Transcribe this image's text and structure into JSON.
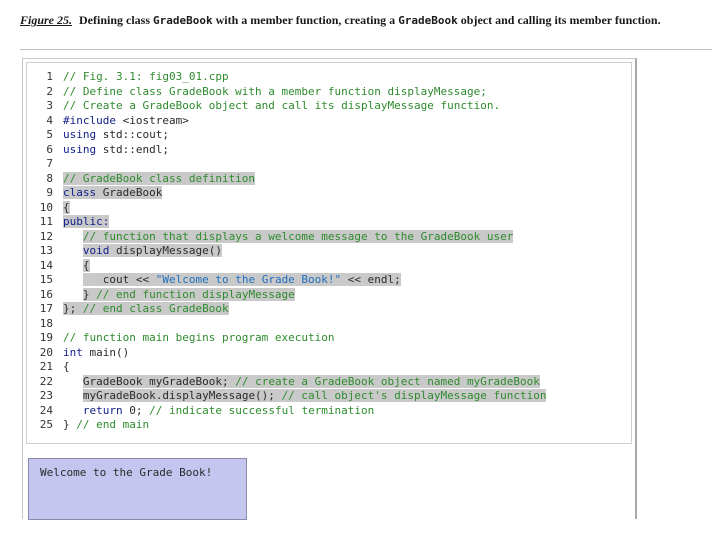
{
  "caption": {
    "figure_label": "Figure 25.",
    "text_1": "Defining class",
    "code_1": "GradeBook",
    "text_2": "with a member function, creating a",
    "code_2": "GradeBook",
    "text_3": "object and calling its member function."
  },
  "code_lines": [
    {
      "n": "1",
      "segs": [
        {
          "c": "cm",
          "t": "// Fig. 3.1: fig03_01.cpp"
        }
      ]
    },
    {
      "n": "2",
      "segs": [
        {
          "c": "cm",
          "t": "// Define class GradeBook with a member function displayMessage;"
        }
      ]
    },
    {
      "n": "3",
      "segs": [
        {
          "c": "cm",
          "t": "// Create a GradeBook object and call its displayMessage function."
        }
      ]
    },
    {
      "n": "4",
      "segs": [
        {
          "c": "kw",
          "t": "#include"
        },
        {
          "c": "tx",
          "t": " <iostream>"
        }
      ]
    },
    {
      "n": "5",
      "segs": [
        {
          "c": "kw",
          "t": "using"
        },
        {
          "c": "tx",
          "t": " std::cout;"
        }
      ]
    },
    {
      "n": "6",
      "segs": [
        {
          "c": "kw",
          "t": "using"
        },
        {
          "c": "tx",
          "t": " std::endl;"
        }
      ]
    },
    {
      "n": "7",
      "segs": []
    },
    {
      "n": "8",
      "segs": [
        {
          "c": "cm hl",
          "t": "// GradeBook class definition"
        }
      ]
    },
    {
      "n": "9",
      "segs": [
        {
          "c": "kw hl",
          "t": "class"
        },
        {
          "c": "tx hl",
          "t": " GradeBook"
        }
      ]
    },
    {
      "n": "10",
      "segs": [
        {
          "c": "tx hl",
          "t": "{"
        }
      ]
    },
    {
      "n": "11",
      "segs": [
        {
          "c": "kw hl",
          "t": "public:"
        }
      ]
    },
    {
      "n": "12",
      "segs": [
        {
          "c": "tx",
          "t": "   "
        },
        {
          "c": "cm hl",
          "t": "// function that displays a welcome message to the GradeBook user"
        }
      ]
    },
    {
      "n": "13",
      "segs": [
        {
          "c": "tx",
          "t": "   "
        },
        {
          "c": "kw hl",
          "t": "void"
        },
        {
          "c": "tx hl",
          "t": " displayMessage()"
        }
      ]
    },
    {
      "n": "14",
      "segs": [
        {
          "c": "tx",
          "t": "   "
        },
        {
          "c": "tx hl",
          "t": "{"
        }
      ]
    },
    {
      "n": "15",
      "segs": [
        {
          "c": "tx",
          "t": "   "
        },
        {
          "c": "tx hl",
          "t": "   cout << "
        },
        {
          "c": "st hl",
          "t": "\"Welcome to the Grade Book!\""
        },
        {
          "c": "tx hl",
          "t": " << endl;"
        }
      ]
    },
    {
      "n": "16",
      "segs": [
        {
          "c": "tx",
          "t": "   "
        },
        {
          "c": "tx hl",
          "t": "} "
        },
        {
          "c": "cm hl",
          "t": "// end function displayMessage"
        }
      ]
    },
    {
      "n": "17",
      "segs": [
        {
          "c": "tx hl",
          "t": "}; "
        },
        {
          "c": "cm hl",
          "t": "// end class GradeBook"
        }
      ]
    },
    {
      "n": "18",
      "segs": []
    },
    {
      "n": "19",
      "segs": [
        {
          "c": "cm",
          "t": "// function main begins program execution"
        }
      ]
    },
    {
      "n": "20",
      "segs": [
        {
          "c": "kw",
          "t": "int"
        },
        {
          "c": "tx",
          "t": " main()"
        }
      ]
    },
    {
      "n": "21",
      "segs": [
        {
          "c": "tx",
          "t": "{"
        }
      ]
    },
    {
      "n": "22",
      "segs": [
        {
          "c": "tx",
          "t": "   "
        },
        {
          "c": "tx hl",
          "t": "GradeBook myGradeBook; "
        },
        {
          "c": "cm hl",
          "t": "// create a GradeBook object named myGradeBook"
        }
      ]
    },
    {
      "n": "23",
      "segs": [
        {
          "c": "tx",
          "t": "   "
        },
        {
          "c": "tx hl",
          "t": "myGradeBook.displayMessage(); "
        },
        {
          "c": "cm hl",
          "t": "// call object's displayMessage function"
        }
      ]
    },
    {
      "n": "24",
      "segs": [
        {
          "c": "tx",
          "t": "   "
        },
        {
          "c": "kw",
          "t": "return"
        },
        {
          "c": "tx",
          "t": " 0; "
        },
        {
          "c": "cm",
          "t": "// indicate successful termination"
        }
      ]
    },
    {
      "n": "25",
      "segs": [
        {
          "c": "tx",
          "t": "} "
        },
        {
          "c": "cm",
          "t": "// end main"
        }
      ]
    }
  ],
  "output": {
    "text": "Welcome to the Grade Book!"
  }
}
